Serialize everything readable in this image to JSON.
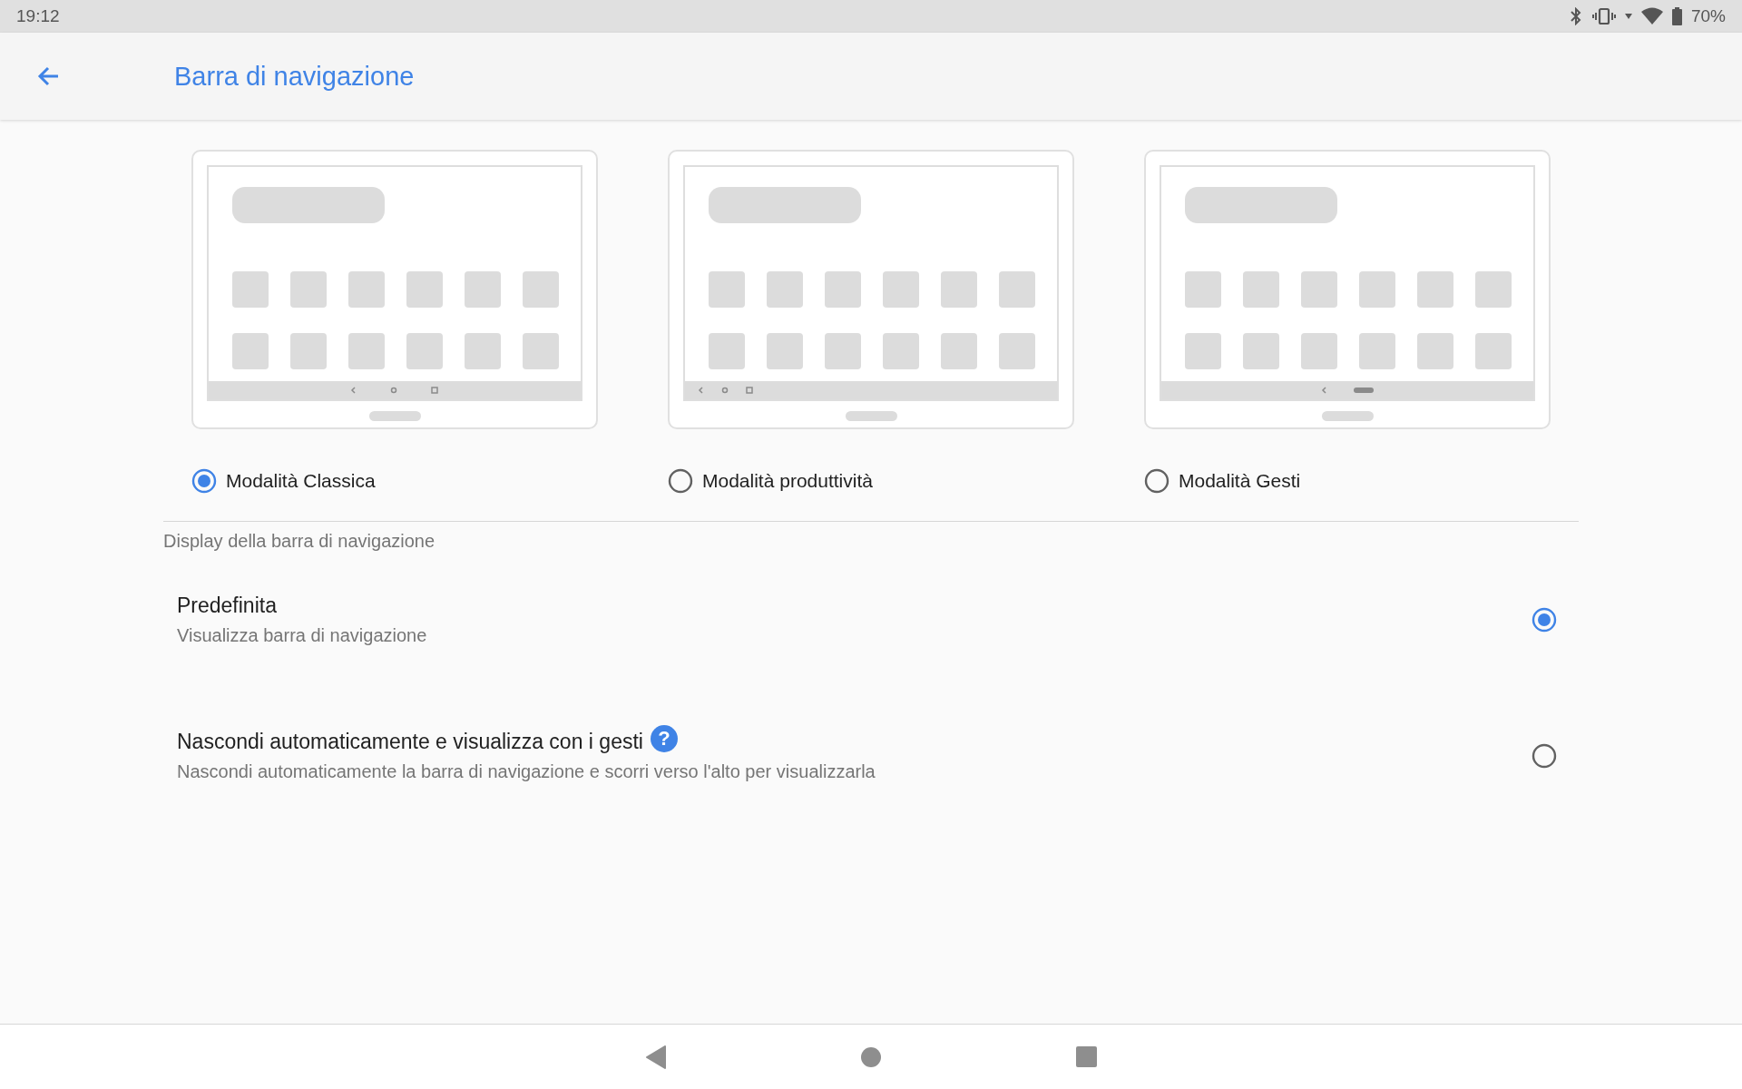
{
  "status_bar": {
    "time": "19:12",
    "battery": "70%"
  },
  "header": {
    "title": "Barra di navigazione"
  },
  "modes": [
    {
      "label": "Modalità Classica",
      "selected": true,
      "kind": "classic"
    },
    {
      "label": "Modalità produttività",
      "selected": false,
      "kind": "productivity"
    },
    {
      "label": "Modalità Gesti",
      "selected": false,
      "kind": "gestures"
    }
  ],
  "section": {
    "title": "Display della barra di navigazione"
  },
  "options": [
    {
      "title": "Predefinita",
      "subtitle": "Visualizza barra di navigazione",
      "selected": true
    },
    {
      "title": "Nascondi automaticamente e visualizza con i gesti",
      "help": "?",
      "subtitle": "Nascondi automaticamente la barra di navigazione e scorri verso l'alto per visualizzarla",
      "selected": false
    }
  ]
}
